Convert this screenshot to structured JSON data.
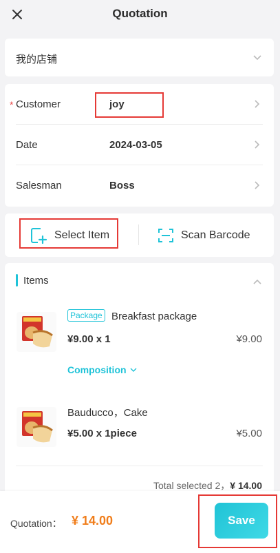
{
  "header": {
    "title": "Quotation",
    "close_icon": "close-icon"
  },
  "store": {
    "name": "我的店铺",
    "chevron_icon": "chevron-down-icon"
  },
  "info": {
    "customer": {
      "label": "Customer",
      "value": "joy",
      "required": true
    },
    "date": {
      "label": "Date",
      "value": "2024-03-05"
    },
    "salesman": {
      "label": "Salesman",
      "value": "Boss"
    },
    "row_icon": "chevron-right-icon"
  },
  "actions": {
    "select_item": {
      "label": "Select Item",
      "icon": "add-item-icon"
    },
    "scan_barcode": {
      "label": "Scan Barcode",
      "icon": "scan-icon"
    }
  },
  "items": {
    "title": "Items",
    "collapse_icon": "chevron-up-icon",
    "list": [
      {
        "badge": "Package",
        "name": "Breakfast package",
        "qty_text": "¥9.00 x 1",
        "total": "¥9.00",
        "composition_label": "Composition"
      },
      {
        "name": "Bauducco，Cake",
        "qty_text": "¥5.00 x 1piece",
        "total": "¥5.00"
      }
    ],
    "summary_prefix": "Total selected 2，",
    "summary_amount": "¥ 14.00"
  },
  "footer": {
    "label": "Quotation：",
    "amount": "¥ 14.00",
    "save_label": "Save"
  },
  "colors": {
    "accent": "#1fc3d8",
    "amount": "#f07d1a",
    "required": "#e84444",
    "highlight": "#e53935"
  }
}
